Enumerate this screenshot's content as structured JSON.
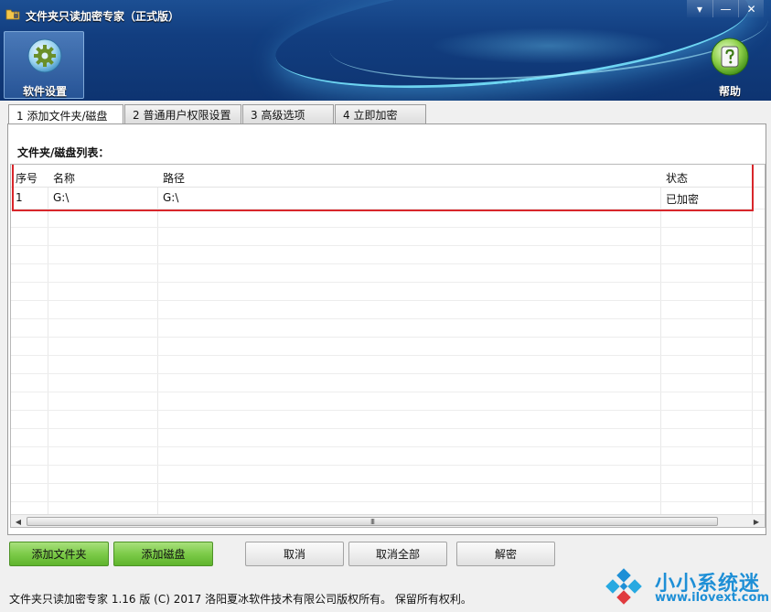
{
  "window": {
    "title": "文件夹只读加密专家（正式版）",
    "controls": [
      "▾",
      "—",
      "✕"
    ]
  },
  "toolbar": {
    "settings_label": "软件设置",
    "help_label": "帮助"
  },
  "tabs": [
    {
      "label": "1 添加文件夹/磁盘",
      "active": true
    },
    {
      "label": "2 普通用户权限设置",
      "active": false
    },
    {
      "label": "3 高级选项",
      "active": false
    },
    {
      "label": "4 立即加密",
      "active": false
    }
  ],
  "list": {
    "caption": "文件夹/磁盘列表：",
    "columns": [
      "序号",
      "名称",
      "路径",
      "状态"
    ],
    "rows": [
      {
        "index": "1",
        "name": "G:\\",
        "path": "G:\\",
        "status": "已加密"
      }
    ],
    "scroll_grip": "III"
  },
  "buttons": {
    "add_folder": "添加文件夹",
    "add_disk": "添加磁盘",
    "cancel": "取消",
    "cancel_all": "取消全部",
    "decrypt": "解密"
  },
  "footer": {
    "copyright": "文件夹只读加密专家 1.16 版 (C) 2017 洛阳夏冰软件技术有限公司版权所有。 保留所有权利。"
  },
  "watermark": {
    "name": "小小系统迷",
    "url": "www.ilovext.com"
  },
  "colors": {
    "header_blue": "#123e80",
    "accent_green": "#7ccb49",
    "highlight_red": "#d8262b",
    "brand_blue": "#1e8fd6"
  }
}
